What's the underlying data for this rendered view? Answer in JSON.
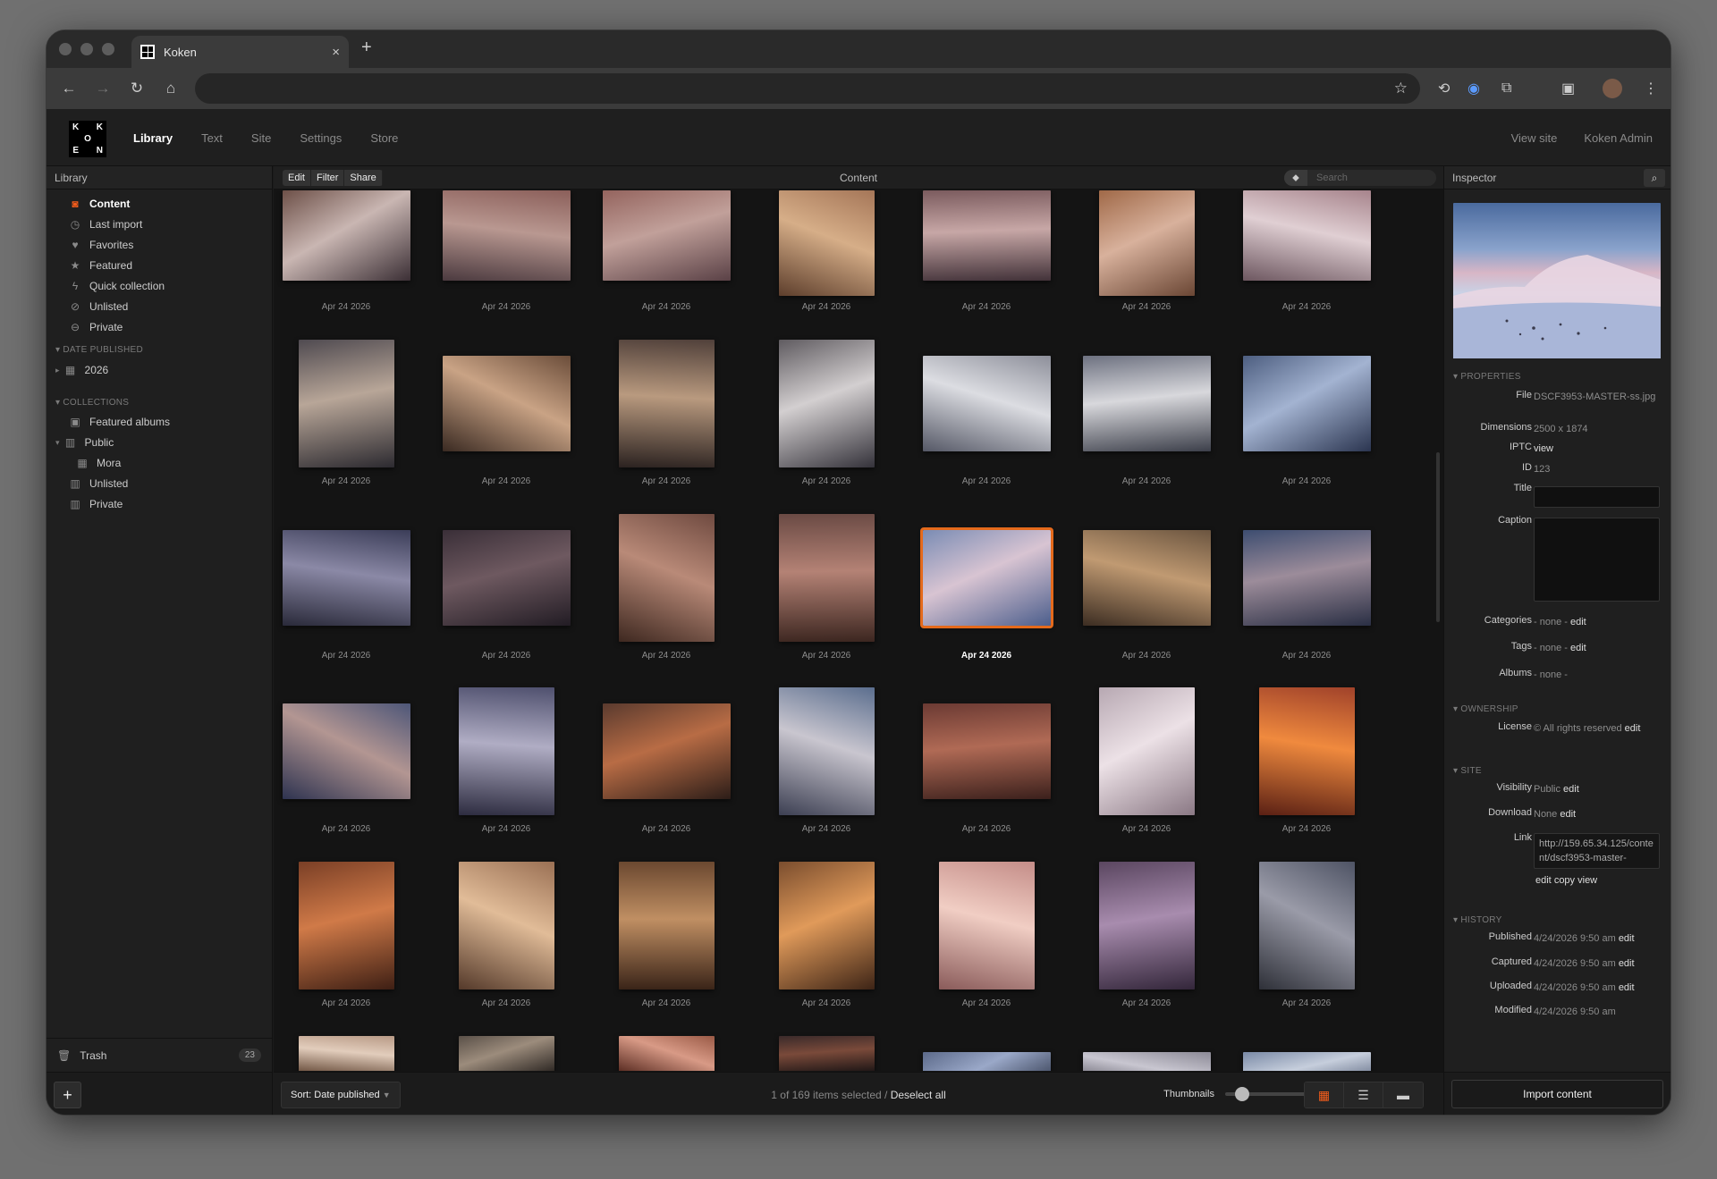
{
  "browser": {
    "tab_title": "Koken",
    "new_tab": "+",
    "close": "×",
    "omnibox_value": ""
  },
  "app": {
    "logo": [
      "K",
      "",
      "K",
      "",
      "O",
      "",
      "E",
      "",
      "N"
    ],
    "nav": [
      "Library",
      "Text",
      "Site",
      "Settings",
      "Store"
    ],
    "nav_right": [
      "View site",
      "Koken Admin"
    ]
  },
  "sidebar": {
    "title": "Library",
    "items": [
      {
        "label": "Content",
        "icon": "camera-icon",
        "active": true
      },
      {
        "label": "Last import",
        "icon": "clock-icon"
      },
      {
        "label": "Favorites",
        "icon": "heart-icon"
      },
      {
        "label": "Featured",
        "icon": "star-icon"
      },
      {
        "label": "Quick collection",
        "icon": "lightning-icon"
      },
      {
        "label": "Unlisted",
        "icon": "unlisted-icon"
      },
      {
        "label": "Private",
        "icon": "private-icon"
      }
    ],
    "date_section": "DATE PUBLISHED",
    "date_items": [
      {
        "label": "2026"
      }
    ],
    "collections_section": "COLLECTIONS",
    "collections": [
      {
        "label": "Featured albums"
      },
      {
        "label": "Public"
      },
      {
        "label": "Mora"
      },
      {
        "label": "Unlisted"
      },
      {
        "label": "Private"
      }
    ],
    "trash_label": "Trash",
    "trash_count": "23",
    "add_label": "+"
  },
  "content": {
    "title": "Content",
    "tools": [
      "Edit",
      "Filter",
      "Share"
    ],
    "search_placeholder": "Search",
    "thumb_date": "Apr 24 2026",
    "selected_index": 18,
    "sort_label": "Sort: Date published",
    "selection_text": "1 of 169 items selected",
    "separator": "/",
    "deselect_label": "Deselect all",
    "thumbnails_label": "Thumbnails",
    "thumbnail_size_fraction": 0.15
  },
  "inspector": {
    "title": "Inspector",
    "properties_section": "PROPERTIES",
    "file_label": "File",
    "file_value": "DSCF3953-MASTER-ss.jpg",
    "dimensions_label": "Dimensions",
    "dimensions_value": "2500 x 1874",
    "iptc_label": "IPTC",
    "iptc_value": "view",
    "id_label": "ID",
    "id_value": "123",
    "title_label": "Title",
    "caption_label": "Caption",
    "categories_label": "Categories",
    "categories_value": "- none -",
    "tags_label": "Tags",
    "tags_value": "- none -",
    "albums_label": "Albums",
    "albums_value": "- none -",
    "edit_label": "edit",
    "ownership_section": "OWNERSHIP",
    "license_label": "License",
    "license_value": "© All rights reserved",
    "site_section": "SITE",
    "visibility_label": "Visibility",
    "visibility_value": "Public",
    "download_label": "Download",
    "download_value": "None",
    "link_label": "Link",
    "link_value": "http://159.65.34.125/content/dscf3953-master-",
    "link_actions": [
      "edit",
      "copy",
      "view"
    ],
    "history_section": "HISTORY",
    "published_label": "Published",
    "published_value": "4/24/2026 9:50 am",
    "captured_label": "Captured",
    "captured_value": "4/24/2026 9:50 am",
    "uploaded_label": "Uploaded",
    "uploaded_value": "4/24/2026 9:50 am",
    "modified_label": "Modified",
    "modified_value": "4/24/2026 9:50 am",
    "import_label": "Import content"
  }
}
